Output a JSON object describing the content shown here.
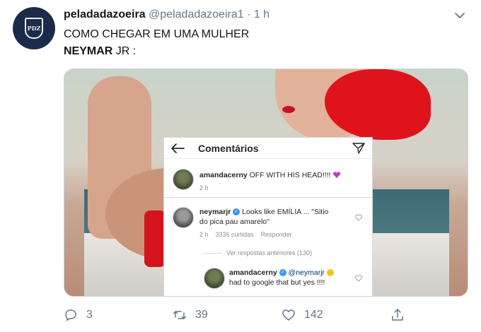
{
  "tweet": {
    "display_name": "peladadazoeira",
    "handle": "@peladadazoeira1",
    "separator": "·",
    "time": "1 h",
    "avatar_text": "PDZ",
    "text_line1": "COMO CHEGAR EM UMA MULHER",
    "text_line2_bold": "NEYMAR",
    "text_line2_rest": " JR :"
  },
  "embedded": {
    "title": "Comentários",
    "comments": [
      {
        "username": "amandacerny",
        "text": "OFF WITH HIS HEAD!!!! ",
        "time": "2 h"
      },
      {
        "username": "neymarjr",
        "text_line1": " Looks like EMÍLIA ... \"Sitio",
        "text_line2": "do pica pau amarelo\"",
        "time": "2 h",
        "likes": "3336 curtidas",
        "reply": "Responder"
      }
    ],
    "view_previous": "Ver respostas anteriores (130)",
    "reply": {
      "username": "amandacerny",
      "mention": " @neymarjr ",
      "text_line2": "had to google that but yes !!!!"
    }
  },
  "actions": {
    "replies": "3",
    "retweets": "39",
    "likes": "142"
  },
  "colors": {
    "text_primary": "#14171a",
    "text_secondary": "#657786",
    "avatar_bg": "#1d2b4a",
    "instagram_verified": "#3897f0",
    "heart": "#c03cc8"
  }
}
